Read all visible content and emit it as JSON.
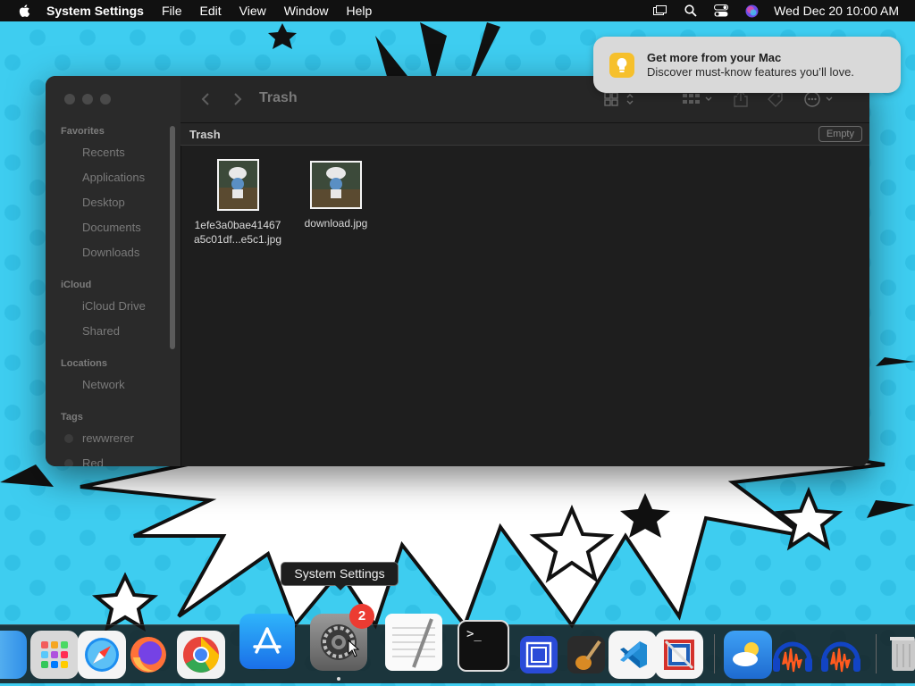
{
  "menubar": {
    "app_name": "System Settings",
    "menus": [
      "File",
      "Edit",
      "View",
      "Window",
      "Help"
    ],
    "clock": "Wed Dec 20  10:00 AM"
  },
  "notification": {
    "title": "Get more from your Mac",
    "body": "Discover must-know features you’ll love."
  },
  "finder": {
    "window_title": "Trash",
    "path_label": "Trash",
    "empty_button": "Empty",
    "sidebar": {
      "favorites_header": "Favorites",
      "favorites": [
        "Recents",
        "Applications",
        "Desktop",
        "Documents",
        "Downloads"
      ],
      "icloud_header": "iCloud",
      "icloud": [
        "iCloud Drive",
        "Shared"
      ],
      "locations_header": "Locations",
      "locations": [
        "Network"
      ],
      "tags_header": "Tags",
      "tags": [
        "rewwrerer",
        "Red"
      ]
    },
    "files": [
      {
        "name_line1": "1efe3a0bae41467",
        "name_line2": "a5c01df...e5c1.jpg"
      },
      {
        "name_line1": "download.jpg",
        "name_line2": ""
      }
    ]
  },
  "tooltip": "System Settings",
  "dock": {
    "settings_badge": "2",
    "apps": [
      "Finder",
      "Launchpad",
      "Safari",
      "Firefox",
      "Chrome",
      "App Store",
      "System Settings",
      "TextEdit",
      "Terminal",
      "Screen Sharing",
      "GarageBand",
      "Visual Studio Code",
      "Parallels",
      "Weather",
      "Audacity",
      "Audacity",
      "Trash"
    ]
  },
  "colors": {
    "wallpaper": "#3ecdf0",
    "badge": "#ec3b32",
    "notification_bulb": "#f6c02c"
  }
}
